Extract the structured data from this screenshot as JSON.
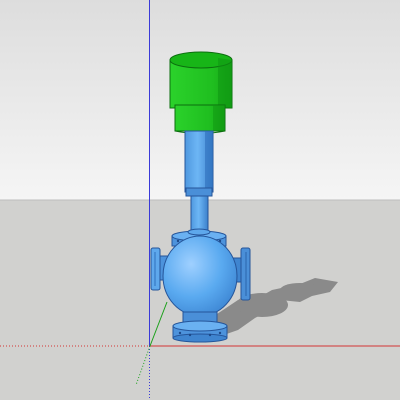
{
  "viewport": {
    "kind": "3d-modeling-canvas",
    "model": "three-way-control-valve-with-actuator",
    "colors": {
      "sky_top": "#e2e2e2",
      "sky_bottom": "#f4f4f4",
      "ground": "#d1d1cf",
      "shadow": "#8b8b8b",
      "actuator_green": "#22c522",
      "actuator_green_dark": "#0d8c12",
      "valve_blue": "#56a7ef",
      "valve_blue_dark": "#2f74c2",
      "axis_blue": "#3434d8",
      "axis_red": "#d43535",
      "axis_green": "#1aa01a"
    }
  }
}
